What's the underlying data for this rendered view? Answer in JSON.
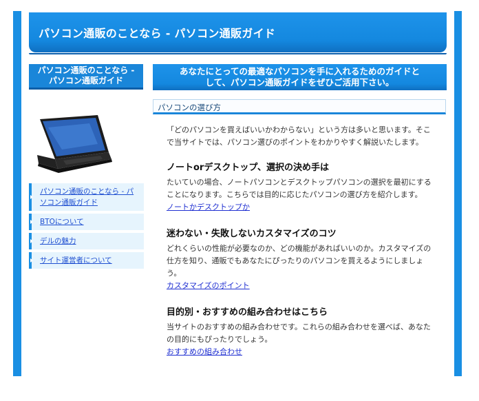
{
  "header": {
    "title": "パソコン通販のことなら - パソコン通販ガイド"
  },
  "sidebar": {
    "title_line1": "パソコン通販のことなら -",
    "title_line2": "パソコン通販ガイド",
    "items": [
      {
        "label": "パソコン通販のことなら - パソコン通販ガイド"
      },
      {
        "label": "BTOについて"
      },
      {
        "label": "デルの魅力"
      },
      {
        "label": "サイト運営者について"
      }
    ]
  },
  "main": {
    "banner_line1": "あなたにとっての最適なパソコンを手に入れるためのガイドと",
    "banner_line2": "して、パソコン通販ガイドをぜひご活用下さい。",
    "section_title": "パソコンの選び方",
    "intro": "「どのパソコンを買えばいいかわからない」という方は多いと思います。そこで当サイトでは、パソコン選びのポイントをわかりやすく解説いたします。",
    "blocks": [
      {
        "heading": "ノートorデスクトップ、選択の決め手は",
        "text": "たいていの場合、ノートパソコンとデスクトップパソコンの選択を最初にすることになります。こちらでは目的に応じたパソコンの選び方を紹介します。",
        "link": "ノートかデスクトップか"
      },
      {
        "heading": "迷わない・失敗しないカスタマイズのコツ",
        "text": "どれくらいの性能が必要なのか、どの機能があればいいのか。カスタマイズの仕方を知り、通販でもあなたにぴったりのパソコンを買えるようにしましょう。",
        "link": "カスタマイズのポイント"
      },
      {
        "heading": "目的別・おすすめの組み合わせはこちら",
        "text": "当サイトのおすすめの組み合わせです。これらの組み合わせを選べば、あなたの目的にもぴったりでしょう。",
        "link": "おすすめの組み合わせ"
      }
    ]
  }
}
